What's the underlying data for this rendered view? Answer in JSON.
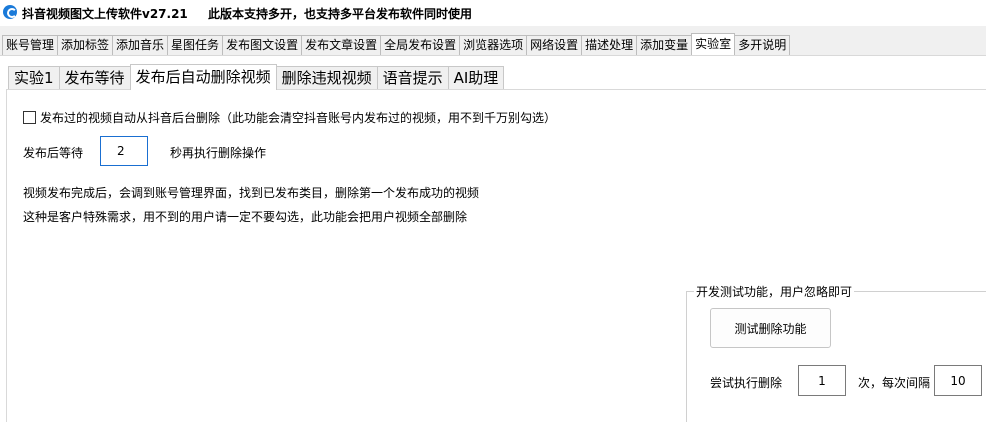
{
  "window": {
    "title": "抖音视频图文上传软件v27.21",
    "note": "此版本支持多开，也支持多平台发布软件同时使用"
  },
  "main_tabs": [
    "账号管理",
    "添加标签",
    "添加音乐",
    "星图任务",
    "发布图文设置",
    "发布文章设置",
    "全局发布设置",
    "浏览器选项",
    "网络设置",
    "描述处理",
    "添加变量",
    "实验室",
    "多开说明"
  ],
  "sub_tabs": [
    "实验1",
    "发布等待",
    "发布后自动删除视频",
    "删除违规视频",
    "语音提示",
    "AI助理"
  ],
  "panel": {
    "auto_delete_checkbox": "发布过的视频自动从抖音后台删除（此功能会清空抖音账号内发布过的视频，用不到千万别勾选）",
    "wait_prefix": "发布后等待",
    "wait_value": "2",
    "wait_suffix": "秒再执行删除操作",
    "desc_line1": "视频发布完成后，会调到账号管理界面，找到已发布类目，删除第一个发布成功的视频",
    "desc_line2": "这种是客户特殊需求，用不到的用户请一定不要勾选，此功能会把用户视频全部删除"
  },
  "test_group": {
    "title": "开发测试功能，用户忽略即可",
    "button": "测试删除功能",
    "attempt_label": "尝试执行删除",
    "attempt_value": "1",
    "interval_label": "次，每次间隔",
    "interval_value": "10"
  }
}
